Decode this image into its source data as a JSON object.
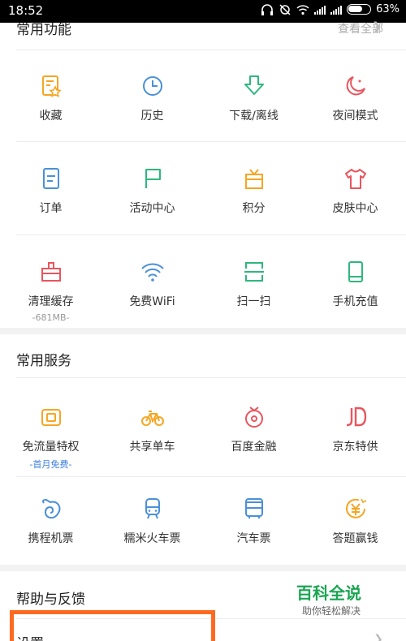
{
  "status_bar": {
    "time": "18:52",
    "battery": "63%"
  },
  "common_functions": {
    "title": "常用功能",
    "more": "查看全部",
    "items": [
      {
        "label": "收藏",
        "icon": "favorites-icon"
      },
      {
        "label": "历史",
        "icon": "clock-icon"
      },
      {
        "label": "下载/离线",
        "icon": "download-icon"
      },
      {
        "label": "夜间模式",
        "icon": "moon-icon"
      },
      {
        "label": "订单",
        "icon": "order-icon"
      },
      {
        "label": "活动中心",
        "icon": "flag-icon"
      },
      {
        "label": "积分",
        "icon": "gift-icon"
      },
      {
        "label": "皮肤中心",
        "icon": "tshirt-icon"
      },
      {
        "label": "清理缓存",
        "sub": "-681MB-",
        "icon": "cleanup-icon"
      },
      {
        "label": "免费WiFi",
        "icon": "wifi-icon"
      },
      {
        "label": "扫一扫",
        "icon": "scan-icon"
      },
      {
        "label": "手机充值",
        "icon": "phone-recharge-icon"
      }
    ]
  },
  "common_services": {
    "title": "常用服务",
    "items": [
      {
        "label": "免流量特权",
        "sub": "-首月免费-",
        "icon": "sim-card-icon"
      },
      {
        "label": "共享单车",
        "icon": "bicycle-icon"
      },
      {
        "label": "百度金融",
        "icon": "finance-icon"
      },
      {
        "label": "京东特供",
        "icon": "jd-icon"
      },
      {
        "label": "携程机票",
        "icon": "ctrip-icon"
      },
      {
        "label": "糯米火车票",
        "icon": "train-icon"
      },
      {
        "label": "汽车票",
        "icon": "bus-icon"
      },
      {
        "label": "答题赢钱",
        "icon": "yuan-coin-icon"
      }
    ]
  },
  "help": {
    "title": "帮助与反馈",
    "settings": "设置"
  },
  "watermark": {
    "title": "百科全说",
    "subtitle": "助你轻松解决"
  },
  "colors": {
    "orange": "#f5a623",
    "blue": "#4a90d9",
    "green": "#2db87d",
    "red": "#e8565e"
  }
}
